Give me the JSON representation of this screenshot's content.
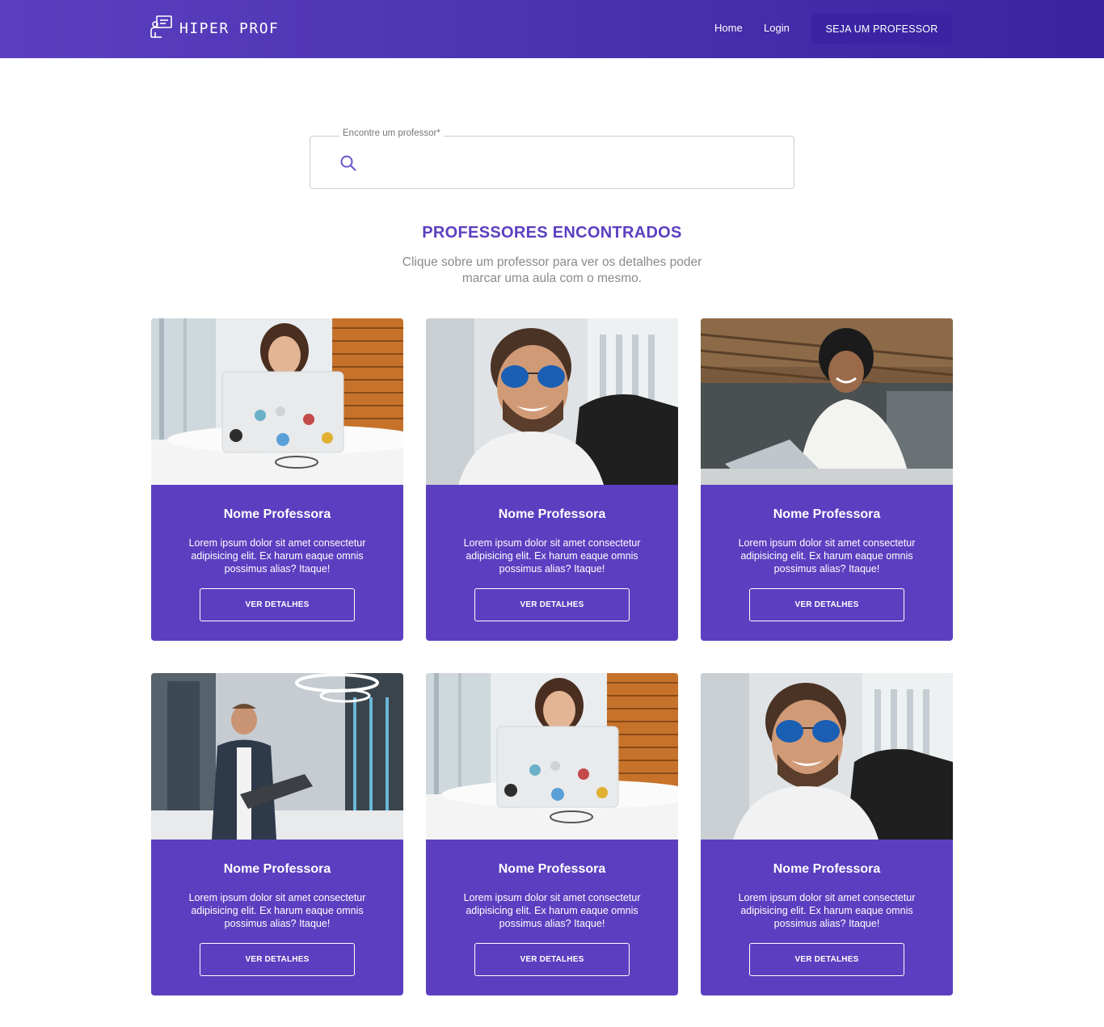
{
  "header": {
    "brand": "HIPER PROF",
    "nav": {
      "home": "Home",
      "login": "Login"
    },
    "cta": "SEJA UM PROFESSOR",
    "colors": {
      "gradient_start": "#5b3fc0",
      "gradient_end": "#3a22a0",
      "cta_bg": "#3b24a3"
    }
  },
  "search": {
    "label": "Encontre um professor*",
    "value": "",
    "placeholder": ""
  },
  "results": {
    "title": "PROFESSORES ENCONTRADOS",
    "subtitle": "Clique sobre um professor para ver os detalhes poder marcar uma aula com o mesmo."
  },
  "cards": [
    {
      "name": "Nome Professora",
      "description": "Lorem ipsum dolor sit amet consectetur adipisicing elit. Ex harum eaque omnis possimus alias? Itaque!",
      "button": "VER DETALHES",
      "photo": "woman-laptop"
    },
    {
      "name": "Nome Professora",
      "description": "Lorem ipsum dolor sit amet consectetur adipisicing elit. Ex harum eaque omnis possimus alias? Itaque!",
      "button": "VER DETALHES",
      "photo": "man-sunglasses"
    },
    {
      "name": "Nome Professora",
      "description": "Lorem ipsum dolor sit amet consectetur adipisicing elit. Ex harum eaque omnis possimus alias? Itaque!",
      "button": "VER DETALHES",
      "photo": "man-office"
    },
    {
      "name": "Nome Professora",
      "description": "Lorem ipsum dolor sit amet consectetur adipisicing elit. Ex harum eaque omnis possimus alias? Itaque!",
      "button": "VER DETALHES",
      "photo": "man-server-room"
    },
    {
      "name": "Nome Professora",
      "description": "Lorem ipsum dolor sit amet consectetur adipisicing elit. Ex harum eaque omnis possimus alias? Itaque!",
      "button": "VER DETALHES",
      "photo": "woman-laptop"
    },
    {
      "name": "Nome Professora",
      "description": "Lorem ipsum dolor sit amet consectetur adipisicing elit. Ex harum eaque omnis possimus alias? Itaque!",
      "button": "VER DETALHES",
      "photo": "man-sunglasses"
    }
  ],
  "accent_color": "#5b3fc0"
}
